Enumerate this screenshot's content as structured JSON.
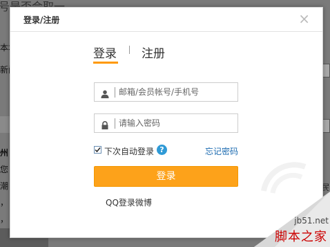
{
  "background": {
    "title_fragment": "号是否会取一...",
    "left_fragments": [
      "本地",
      "新闻",
      "广",
      "州",
      "您",
      "潮",
      "，",
      "，"
    ],
    "right_fragment": "民"
  },
  "dialog": {
    "title": "登录/注册",
    "close_glyph": "×",
    "tabs": {
      "login": "登录",
      "register": "注册"
    },
    "account_placeholder": "邮箱/会员帐号/手机号",
    "password_placeholder": "请输入密码",
    "auto_login_label": "下次自动登录",
    "auto_login_checked": true,
    "help_glyph": "?",
    "forgot_password": "忘记密码",
    "login_button": "登录",
    "social": {
      "qq": "QQ登录",
      "weibo": "微博"
    }
  },
  "watermark": {
    "url": "jb51.net",
    "cn": "脚本之家"
  },
  "colors": {
    "accent_orange": "#fda21a",
    "link_blue": "#1c6bb0",
    "help_blue": "#2f9ad6",
    "watermark_red": "#cc0000"
  },
  "icons": [
    "user-icon",
    "lock-icon",
    "help-icon",
    "close-icon",
    "check-icon"
  ]
}
